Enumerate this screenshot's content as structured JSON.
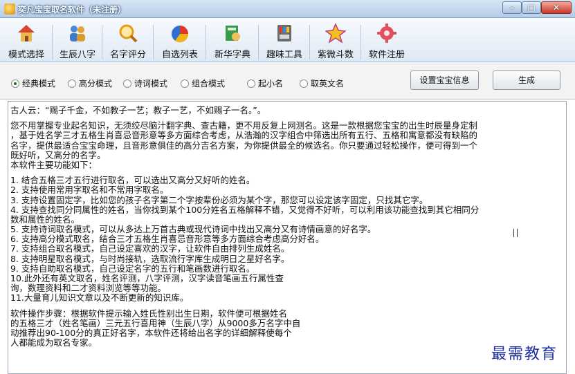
{
  "window": {
    "title": "奕凡宝宝取名软件（未注册）",
    "minimize_glyph": "–",
    "maximize_glyph": "□",
    "close_glyph": "✕"
  },
  "toolbar": {
    "items": [
      {
        "label": "模式选择",
        "icon": "house-icon"
      },
      {
        "label": "生辰八字",
        "icon": "people-icon"
      },
      {
        "label": "名字评分",
        "icon": "magnifier-icon"
      },
      {
        "label": "自选列表",
        "icon": "pie-icon"
      },
      {
        "label": "新华字典",
        "icon": "book-icon"
      },
      {
        "label": "趣味工具",
        "icon": "tools-icon"
      },
      {
        "label": "紫微斗数",
        "icon": "star-icon"
      },
      {
        "label": "软件注册",
        "icon": "gear-icon"
      }
    ]
  },
  "options": {
    "modes": [
      {
        "label": "经典模式",
        "selected": true
      },
      {
        "label": "高分模式",
        "selected": false
      },
      {
        "label": "诗词模式",
        "selected": false
      },
      {
        "label": "组合模式",
        "selected": false
      },
      {
        "label": "起小名",
        "selected": false
      },
      {
        "label": "取英文名",
        "selected": false
      }
    ],
    "set_info_button": "设置宝宝信息",
    "generate_button": "生成"
  },
  "content": {
    "lines": [
      "古人云：“赐子千金，不如教子一艺；教子一艺，不如赐子一名。”。",
      "",
      "您不用掌握专业起名知识，无须绞尽脑汁翻字典、查古籍，更不用反复上网测名。这是一款根据您宝宝的出生时辰量身定制",
      "，基于姓名学三才五格生肖喜忌音形意等多方面综合考虑，从浩瀚的汉字组合中筛选出所有五行、五格和寓意都没有缺陷的",
      "名字，提供最适合宝宝命理，且音形意俱佳的高分吉名方案，为你提供最全的候选名。你只要通过轻松操作，便可得到一个",
      "既好听，又高分的名字。",
      "本软件主要功能如下：",
      "",
      "1. 结合五格三才五行进行取名，可以选出又高分又好听的姓名。",
      "2. 支持使用常用字取名和不常用字取名。",
      "3. 支持设置固定字，比如您的孩子名字第二个字按辈份必须为某个字，那您可以设定该字固定，只找其它字。",
      "4. 支持查找同分同属性的姓名，当你找到某个100分姓名五格解释不错，又觉得不好听，可以利用该功能查找到其它相同分",
      "数和属性的姓名。",
      "5. 支持诗词取名模式，可以从多达上万首古典或现代诗词中找出又高分又有诗情画意的好名字。",
      "6. 支持高分模式取名，结合三才五格生肖喜忌音形意等多方面综合考虑高分好名。",
      "7. 支持组合取名模式，自己设定喜欢的汉字，让软件自由排列生成姓名。",
      "8. 支持明星取名模式，与时尚接轨，选取流行字库生成明日之星好名字。",
      "9. 支持自助取名模式，自己设定名字的五行和笔画数进行取名。",
      "10.此外还有英文取名，姓名评测，八字评测，汉字读音笔画五行属性查",
      "询，数理资料和二才资料浏览等等功能。",
      "11.大量育儿知识文章以及不断更新的知识库。",
      "",
      "软件操作步骤：根据软件提示输入姓氏性别出生日期，软件便可根据姓名",
      "的五格三才（姓名笔画）三元五行喜用神（生辰八字）从9000多万名字中自",
      "动推荐出90-100分的真正好名字，本软件还将给出名字的详细解释使每个",
      "人都能成为取名专家。"
    ]
  },
  "watermark": "最需教育"
}
